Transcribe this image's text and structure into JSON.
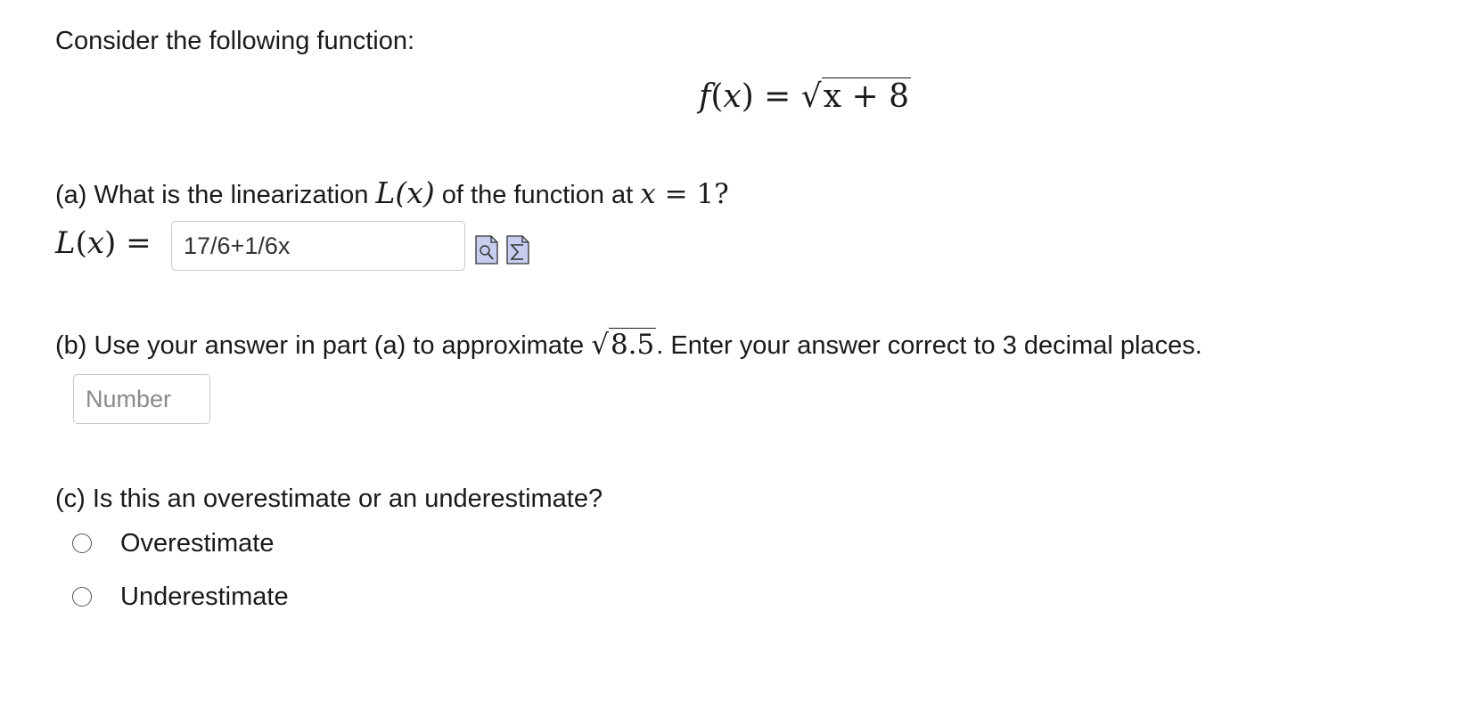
{
  "intro": "Consider the following function:",
  "formula": {
    "lhs": "f(x) = ",
    "radicand": "x + 8"
  },
  "part_a": {
    "question_prefix": "(a) What is the linearization ",
    "question_Lx": "L(x)",
    "question_mid": " of the function at ",
    "question_x": "x",
    "question_eq": " = 1?",
    "label": "L(x) =",
    "answer_value": "17/6+1/6x",
    "preview_icon": "preview-icon",
    "equation_editor_icon": "sigma-icon"
  },
  "part_b": {
    "question_prefix": "(b) Use your answer in part (a) to approximate ",
    "radicand": "8.5",
    "question_suffix": ". Enter your answer correct to 3 decimal places.",
    "input_placeholder": "Number"
  },
  "part_c": {
    "question": "(c) Is this an overestimate or an underestimate?",
    "options": [
      "Overestimate",
      "Underestimate"
    ]
  }
}
